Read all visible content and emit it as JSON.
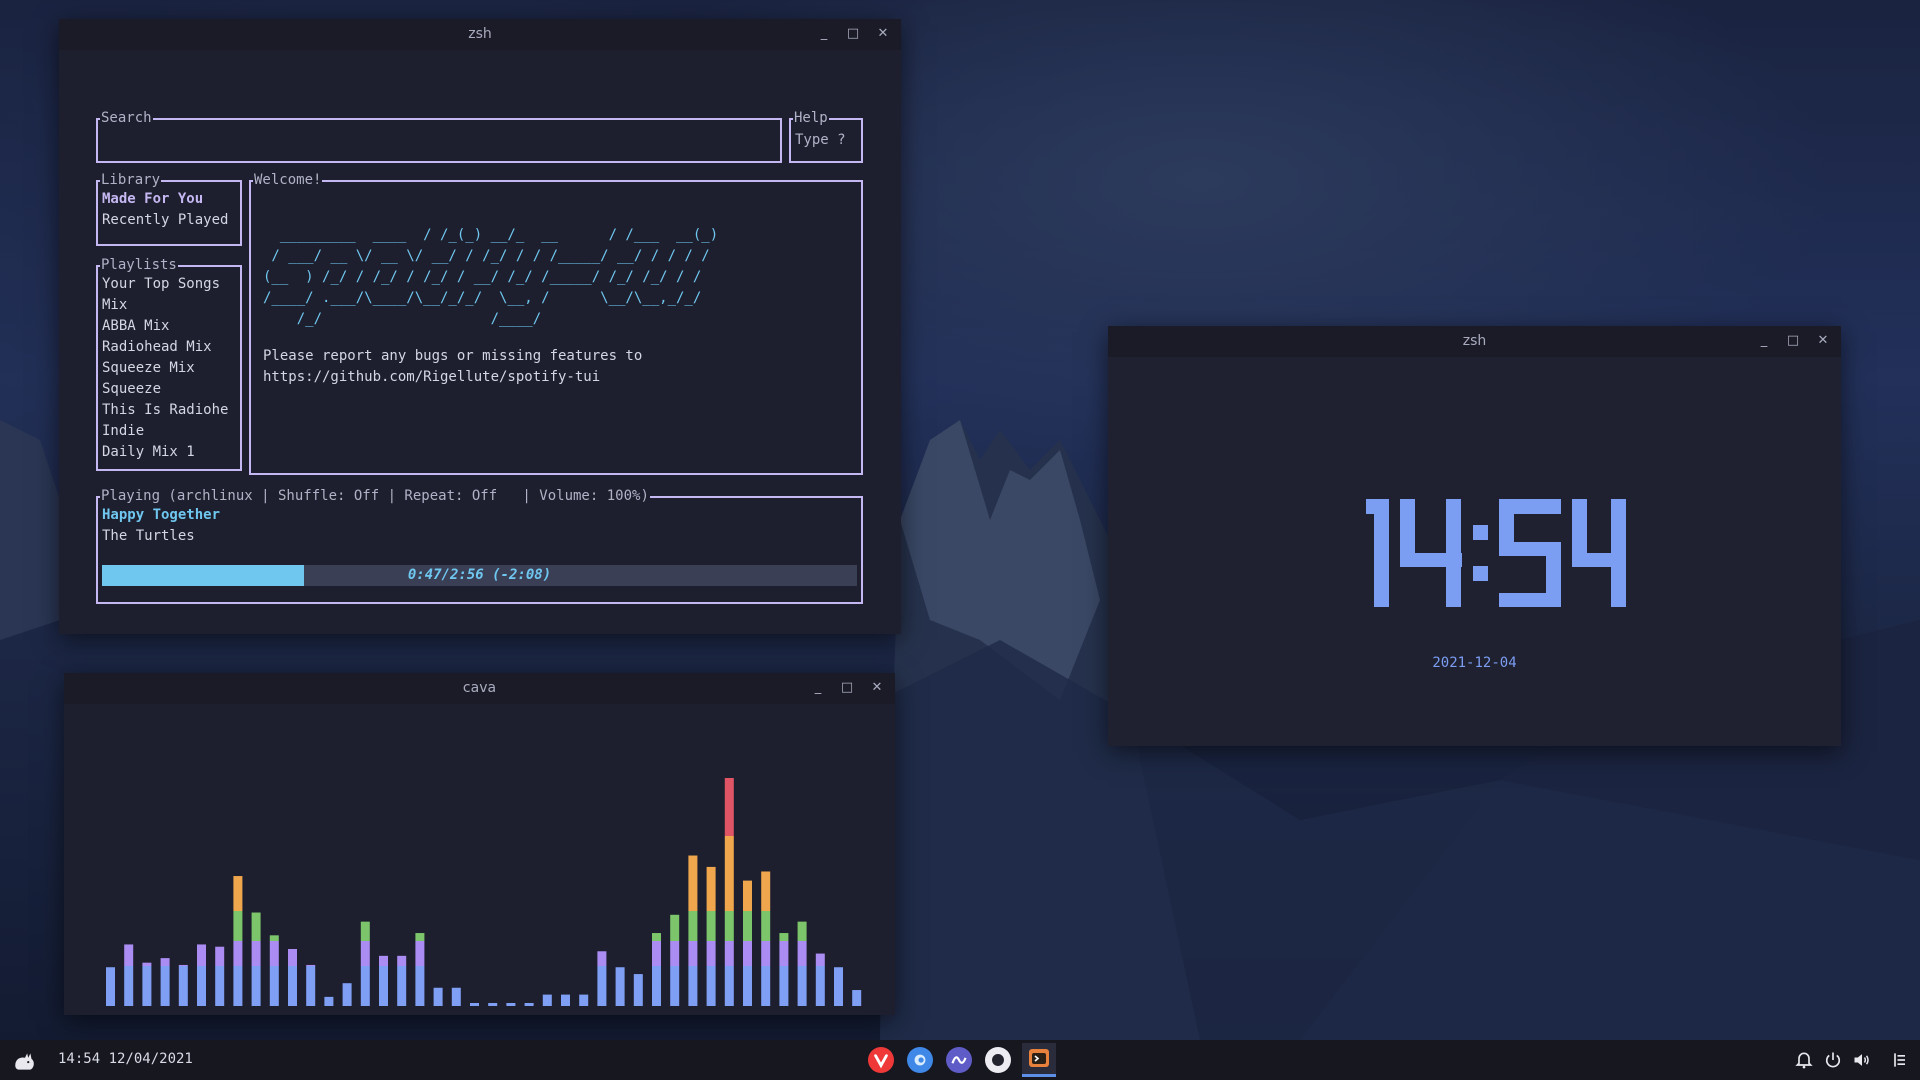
{
  "taskbar": {
    "clock": "14:54 12/04/2021",
    "apps": [
      "vivaldi-icon",
      "app-blue-icon",
      "app-purple-icon",
      "app-record-icon",
      "terminal-icon"
    ],
    "tray": [
      "bell-icon",
      "power-icon",
      "volume-icon",
      "menu-icon"
    ]
  },
  "spotify_window": {
    "title": "zsh",
    "search": {
      "label": "Search",
      "value": ""
    },
    "help": {
      "label": "Help",
      "text": "Type ?"
    },
    "library": {
      "label": "Library",
      "items": [
        "Made For You",
        "Recently Played"
      ]
    },
    "playlists": {
      "label": "Playlists",
      "items": [
        "Your Top Songs",
        "Mix",
        "ABBA Mix",
        "Radiohead Mix",
        "Squeeze Mix",
        "Squeeze",
        "This Is Radiohe",
        "Indie",
        "Daily Mix 1"
      ]
    },
    "welcome": {
      "label": "Welcome!",
      "ascii": [
        "  _________  ____  / /_(_) __/_  __      / /___  __(_)",
        " / ___/ __ \\/ __ \\/ __/ / /_/ / / /_____/ __/ / / / /",
        "(__  ) /_/ / /_/ / /_/ / __/ /_/ /_____/ /_/ /_/ / /",
        "/____/ .___/\\____/\\__/_/_/  \\__, /      \\__/\\__,_/_/",
        "    /_/                    /____/"
      ],
      "message": "Please report any bugs or missing features to",
      "url": "https://github.com/Rigellute/spotify-tui"
    },
    "playing": {
      "label": "Playing (archlinux | Shuffle: Off | Repeat: Off   | Volume: 100%)",
      "track": "Happy Together",
      "artist": "The Turtles",
      "progress_text": "0:47/2:56 (-2:08)",
      "progress": 0.267
    }
  },
  "cava_window": {
    "title": "cava",
    "levels": [
      0.17,
      0.27,
      0.19,
      0.21,
      0.18,
      0.27,
      0.26,
      0.57,
      0.41,
      0.31,
      0.25,
      0.18,
      0.04,
      0.1,
      0.37,
      0.22,
      0.22,
      0.32,
      0.08,
      0.08,
      0.01,
      0.01,
      0.01,
      0.01,
      0.05,
      0.05,
      0.05,
      0.24,
      0.17,
      0.14,
      0.32,
      0.4,
      0.66,
      0.61,
      1.0,
      0.55,
      0.59,
      0.32,
      0.37,
      0.23,
      0.17,
      0.07
    ]
  },
  "clock_window": {
    "title": "zsh",
    "time": "14:54",
    "date": "2021-12-04"
  },
  "colors": {
    "accent": "#c5b8f2",
    "progress": "#6fc7f0",
    "clock": "#7b9ef2",
    "cava_low": "#7f9ff5",
    "cava_mid": "#ab8cf2",
    "cava_green": "#7cc56b",
    "cava_orange": "#f0a64c",
    "cava_red": "#e05565"
  }
}
